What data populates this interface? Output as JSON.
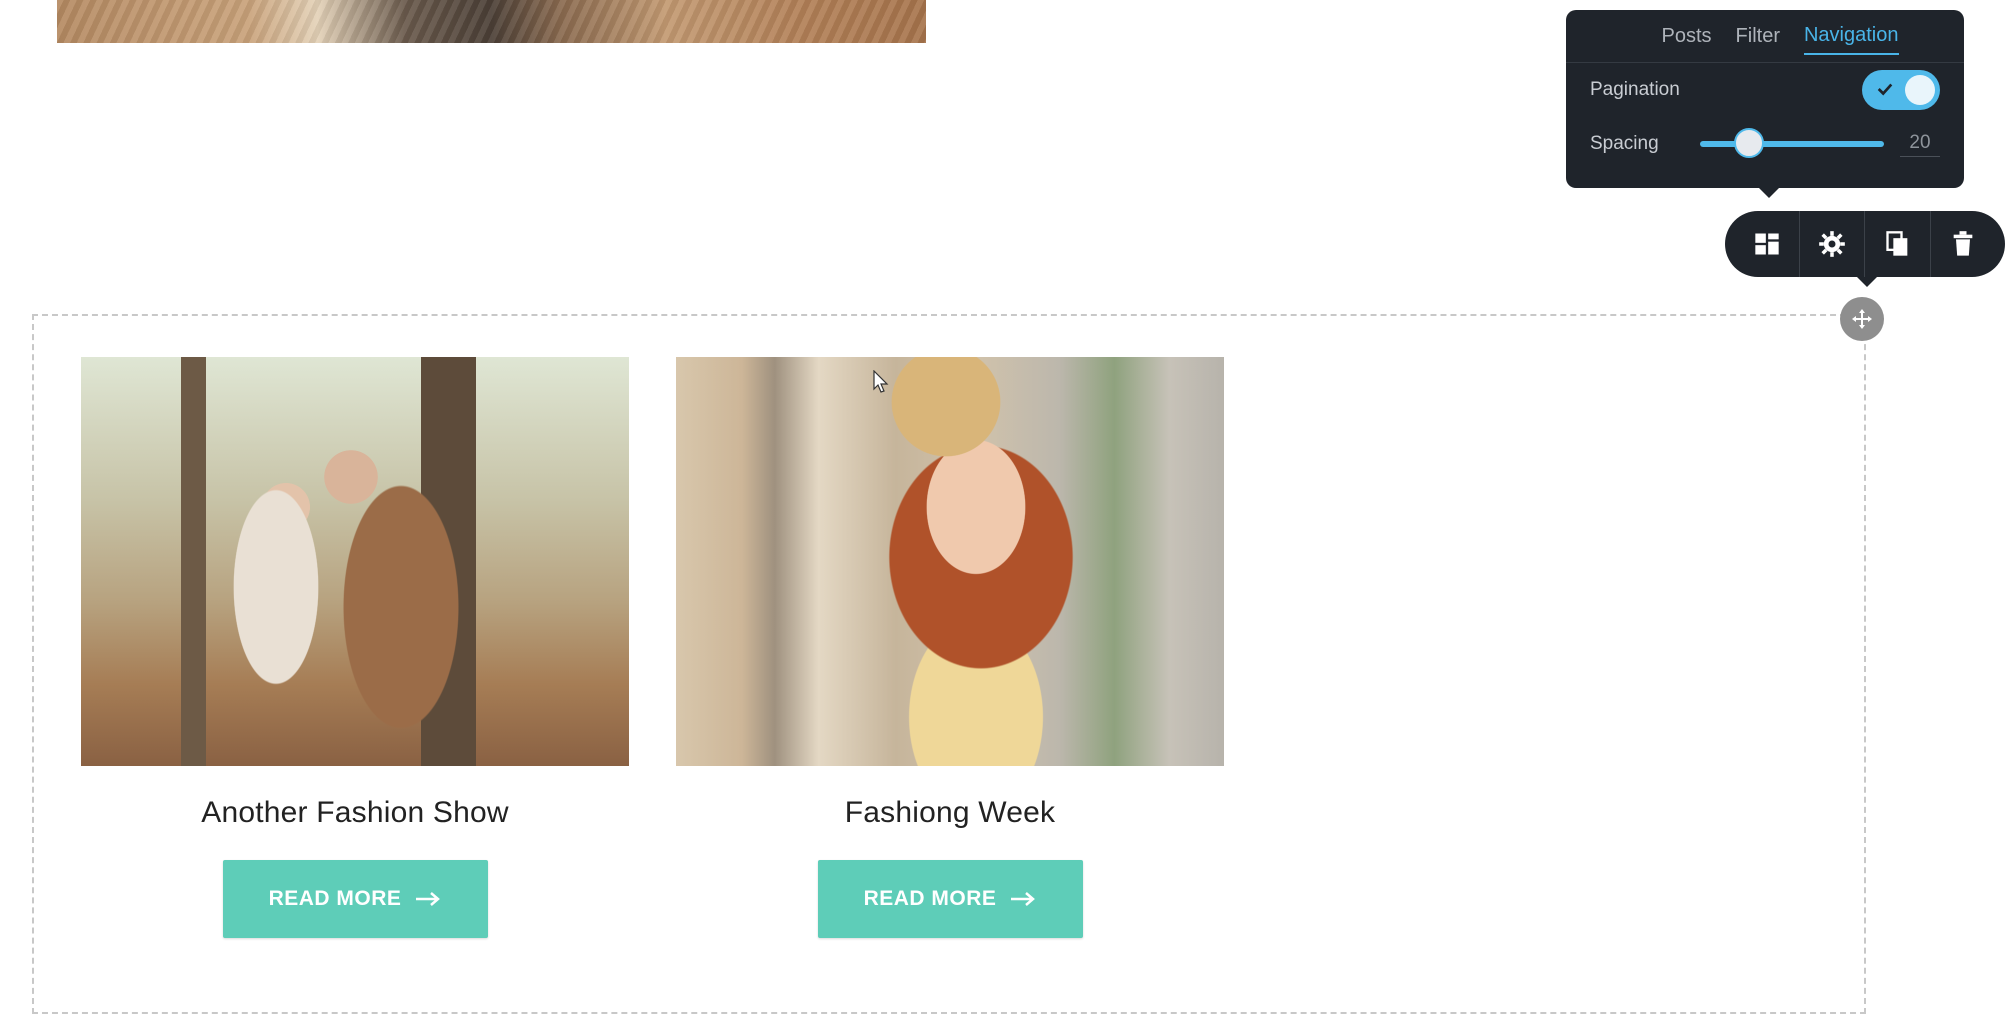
{
  "panel": {
    "tabs": [
      "Posts",
      "Filter",
      "Navigation"
    ],
    "active_tab": "Navigation",
    "pagination_label": "Pagination",
    "pagination_enabled": true,
    "spacing_label": "Spacing",
    "spacing_value": "20"
  },
  "toolbar": {
    "icons": [
      "layout-icon",
      "gear-icon",
      "duplicate-icon",
      "trash-icon"
    ]
  },
  "posts": [
    {
      "title": "Another Fashion Show",
      "button_label": "READ MORE"
    },
    {
      "title": "Fashiong Week",
      "button_label": "READ MORE"
    }
  ],
  "colors": {
    "accent_button": "#5ecdb8",
    "panel_bg": "#1f242b",
    "active_blue": "#49b4e8"
  }
}
